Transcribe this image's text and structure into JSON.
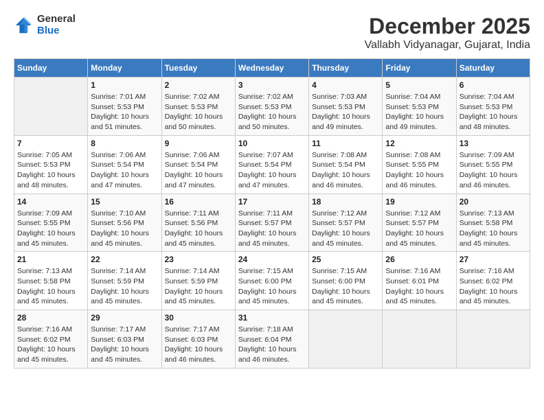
{
  "logo": {
    "general": "General",
    "blue": "Blue"
  },
  "title": "December 2025",
  "location": "Vallabh Vidyanagar, Gujarat, India",
  "headers": [
    "Sunday",
    "Monday",
    "Tuesday",
    "Wednesday",
    "Thursday",
    "Friday",
    "Saturday"
  ],
  "weeks": [
    [
      {
        "day": "",
        "info": ""
      },
      {
        "day": "1",
        "info": "Sunrise: 7:01 AM\nSunset: 5:53 PM\nDaylight: 10 hours\nand 51 minutes."
      },
      {
        "day": "2",
        "info": "Sunrise: 7:02 AM\nSunset: 5:53 PM\nDaylight: 10 hours\nand 50 minutes."
      },
      {
        "day": "3",
        "info": "Sunrise: 7:02 AM\nSunset: 5:53 PM\nDaylight: 10 hours\nand 50 minutes."
      },
      {
        "day": "4",
        "info": "Sunrise: 7:03 AM\nSunset: 5:53 PM\nDaylight: 10 hours\nand 49 minutes."
      },
      {
        "day": "5",
        "info": "Sunrise: 7:04 AM\nSunset: 5:53 PM\nDaylight: 10 hours\nand 49 minutes."
      },
      {
        "day": "6",
        "info": "Sunrise: 7:04 AM\nSunset: 5:53 PM\nDaylight: 10 hours\nand 48 minutes."
      }
    ],
    [
      {
        "day": "7",
        "info": "Sunrise: 7:05 AM\nSunset: 5:53 PM\nDaylight: 10 hours\nand 48 minutes."
      },
      {
        "day": "8",
        "info": "Sunrise: 7:06 AM\nSunset: 5:54 PM\nDaylight: 10 hours\nand 47 minutes."
      },
      {
        "day": "9",
        "info": "Sunrise: 7:06 AM\nSunset: 5:54 PM\nDaylight: 10 hours\nand 47 minutes."
      },
      {
        "day": "10",
        "info": "Sunrise: 7:07 AM\nSunset: 5:54 PM\nDaylight: 10 hours\nand 47 minutes."
      },
      {
        "day": "11",
        "info": "Sunrise: 7:08 AM\nSunset: 5:54 PM\nDaylight: 10 hours\nand 46 minutes."
      },
      {
        "day": "12",
        "info": "Sunrise: 7:08 AM\nSunset: 5:55 PM\nDaylight: 10 hours\nand 46 minutes."
      },
      {
        "day": "13",
        "info": "Sunrise: 7:09 AM\nSunset: 5:55 PM\nDaylight: 10 hours\nand 46 minutes."
      }
    ],
    [
      {
        "day": "14",
        "info": "Sunrise: 7:09 AM\nSunset: 5:55 PM\nDaylight: 10 hours\nand 45 minutes."
      },
      {
        "day": "15",
        "info": "Sunrise: 7:10 AM\nSunset: 5:56 PM\nDaylight: 10 hours\nand 45 minutes."
      },
      {
        "day": "16",
        "info": "Sunrise: 7:11 AM\nSunset: 5:56 PM\nDaylight: 10 hours\nand 45 minutes."
      },
      {
        "day": "17",
        "info": "Sunrise: 7:11 AM\nSunset: 5:57 PM\nDaylight: 10 hours\nand 45 minutes."
      },
      {
        "day": "18",
        "info": "Sunrise: 7:12 AM\nSunset: 5:57 PM\nDaylight: 10 hours\nand 45 minutes."
      },
      {
        "day": "19",
        "info": "Sunrise: 7:12 AM\nSunset: 5:57 PM\nDaylight: 10 hours\nand 45 minutes."
      },
      {
        "day": "20",
        "info": "Sunrise: 7:13 AM\nSunset: 5:58 PM\nDaylight: 10 hours\nand 45 minutes."
      }
    ],
    [
      {
        "day": "21",
        "info": "Sunrise: 7:13 AM\nSunset: 5:58 PM\nDaylight: 10 hours\nand 45 minutes."
      },
      {
        "day": "22",
        "info": "Sunrise: 7:14 AM\nSunset: 5:59 PM\nDaylight: 10 hours\nand 45 minutes."
      },
      {
        "day": "23",
        "info": "Sunrise: 7:14 AM\nSunset: 5:59 PM\nDaylight: 10 hours\nand 45 minutes."
      },
      {
        "day": "24",
        "info": "Sunrise: 7:15 AM\nSunset: 6:00 PM\nDaylight: 10 hours\nand 45 minutes."
      },
      {
        "day": "25",
        "info": "Sunrise: 7:15 AM\nSunset: 6:00 PM\nDaylight: 10 hours\nand 45 minutes."
      },
      {
        "day": "26",
        "info": "Sunrise: 7:16 AM\nSunset: 6:01 PM\nDaylight: 10 hours\nand 45 minutes."
      },
      {
        "day": "27",
        "info": "Sunrise: 7:16 AM\nSunset: 6:02 PM\nDaylight: 10 hours\nand 45 minutes."
      }
    ],
    [
      {
        "day": "28",
        "info": "Sunrise: 7:16 AM\nSunset: 6:02 PM\nDaylight: 10 hours\nand 45 minutes."
      },
      {
        "day": "29",
        "info": "Sunrise: 7:17 AM\nSunset: 6:03 PM\nDaylight: 10 hours\nand 45 minutes."
      },
      {
        "day": "30",
        "info": "Sunrise: 7:17 AM\nSunset: 6:03 PM\nDaylight: 10 hours\nand 46 minutes."
      },
      {
        "day": "31",
        "info": "Sunrise: 7:18 AM\nSunset: 6:04 PM\nDaylight: 10 hours\nand 46 minutes."
      },
      {
        "day": "",
        "info": ""
      },
      {
        "day": "",
        "info": ""
      },
      {
        "day": "",
        "info": ""
      }
    ]
  ]
}
